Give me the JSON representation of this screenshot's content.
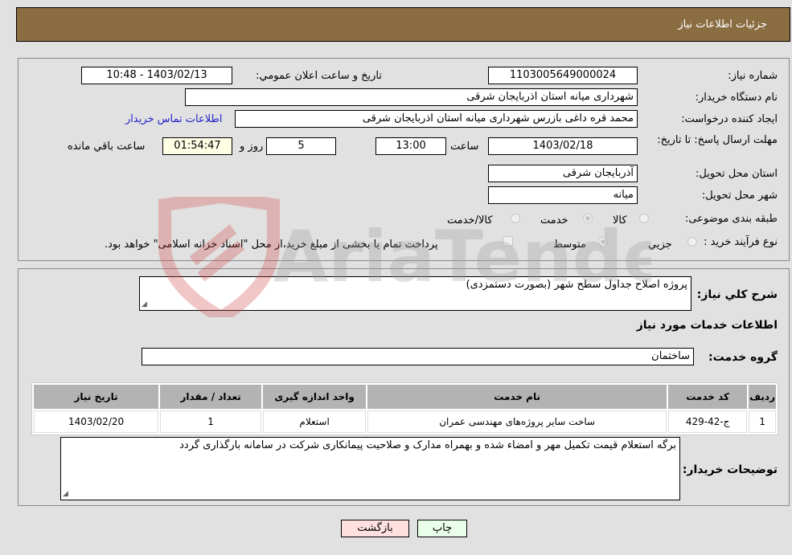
{
  "header": {
    "title": "جزئیات اطلاعات نیاز"
  },
  "details": {
    "need_number_label": "شماره نیاز:",
    "need_number": "1103005649000024",
    "announce_label": "تاریخ و ساعت اعلان عمومي:",
    "announce_value": "1403/02/13 - 10:48",
    "buyer_org_label": "نام دستگاه خریدار:",
    "buyer_org": "شهرداری میانه استان اذربایجان شرقی",
    "creator_label": "ایجاد کننده درخواست:",
    "creator": "محمد قره داغی بازرس شهرداری میانه استان اذربایجان شرقی",
    "contact_link": "اطلاعات تماس خریدار",
    "deadline_label": "مهلت ارسال پاسخ: تا تاریخ:",
    "deadline_date": "1403/02/18",
    "time_label": "ساعت",
    "deadline_time": "13:00",
    "days_value": "5",
    "days_label": "روز و",
    "remaining_time": "01:54:47",
    "remaining_label": "ساعت باقي مانده",
    "province_label": "استان محل تحویل:",
    "province": "آذربایجان شرقی",
    "city_label": "شهر محل تحویل:",
    "city": "میانه",
    "category_label": "طبقه بندی موضوعی:",
    "category_options": [
      {
        "label": "کالا",
        "selected": false
      },
      {
        "label": "خدمت",
        "selected": true
      },
      {
        "label": "کالا/خدمت",
        "selected": false
      }
    ],
    "process_label": "نوع فرآیند خرید :",
    "process_options": [
      {
        "label": "جزيي",
        "selected": false
      },
      {
        "label": "متوسط",
        "selected": true
      }
    ],
    "treasury_note": "پرداخت تمام یا بخشی از مبلغ خرید،از محل \"اسناد خزانه اسلامی\" خواهد بود.",
    "treasury_checked": false
  },
  "services": {
    "description_label": "شرح کلي نیاز:",
    "description": "پروژه اصلاح جداول سطح شهر (بصورت دستمزدی)",
    "section_title": "اطلاعات خدمات مورد نیاز",
    "group_label": "گروه خدمت:",
    "group_value": "ساختمان",
    "table": {
      "headers": [
        "ردیف",
        "کد خدمت",
        "نام خدمت",
        "واحد اندازه گیری",
        "تعداد / مقدار",
        "تاریخ نیاز"
      ],
      "rows": [
        [
          "1",
          "ج-42-429",
          "ساخت سایر پروژه‌های مهندسی عمران",
          "استعلام",
          "1",
          "1403/02/20"
        ]
      ]
    },
    "buyer_notes_label": "توضیحات خریدار:",
    "buyer_notes": "برگه استعلام قیمت تکمیل مهر و امضاء شده و بهمراه مدارک و صلاحیت پیمانکاری شرکت در سامانه بارگذاری گردد"
  },
  "buttons": {
    "print": "چاپ",
    "back": "بازگشت"
  },
  "watermark": {
    "text": "AriaTender.neT"
  },
  "colors": {
    "header_bg": "#8b6d42",
    "print_bg": "#eaffea",
    "back_bg": "#ffe0e0",
    "link": "#2222cc"
  }
}
